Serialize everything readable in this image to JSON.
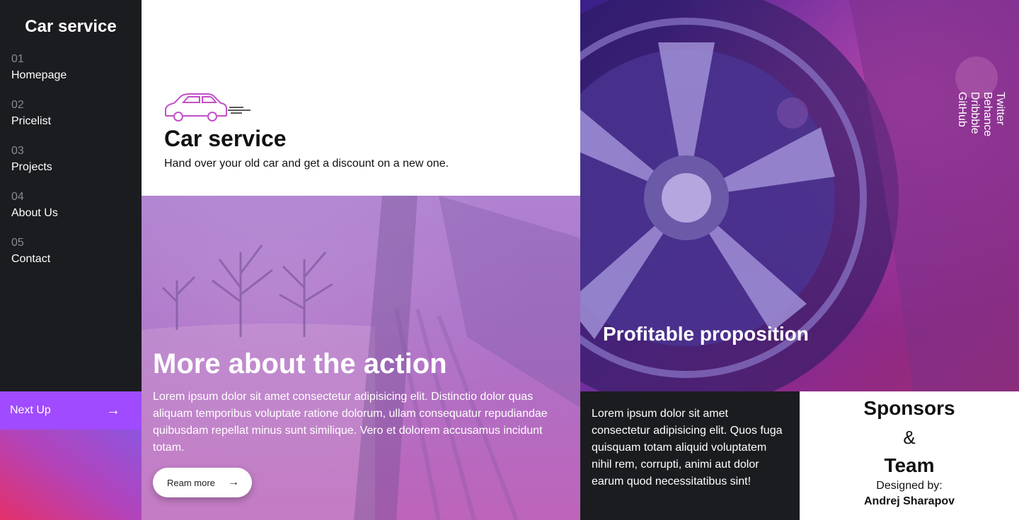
{
  "sidebar": {
    "brand": "Car service",
    "items": [
      {
        "num": "01",
        "label": "Homepage"
      },
      {
        "num": "02",
        "label": "Pricelist"
      },
      {
        "num": "03",
        "label": "Projects"
      },
      {
        "num": "04",
        "label": "About Us"
      },
      {
        "num": "05",
        "label": "Contact"
      }
    ],
    "next_up": "Next Up",
    "next_arrow": "→"
  },
  "hero": {
    "icon": "car-icon",
    "title": "Car service",
    "subtitle": "Hand over your old car and get a discount on a new one."
  },
  "action": {
    "title": "More about the action",
    "text": "Lorem ipsum dolor sit amet consectetur adipisicing elit. Distinctio dolor quas aliquam temporibus voluptate ratione dolorum, ullam consequatur repudiandae quibusdam repellat minus sunt similique. Vero et dolorem accusamus incidunt totam.",
    "button_label": "Ream more",
    "button_arrow": "→"
  },
  "wheel_panel": {
    "title": "Profitable proposition",
    "social": [
      "Twitter",
      "Behance",
      "Dribbble",
      "GitHub"
    ]
  },
  "dark_text": "Lorem ipsum dolor sit amet consectetur adipisicing elit. Quos fuga quisquam totam aliquid voluptatem nihil rem, corrupti, animi aut dolor earum quod necessitatibus sint!",
  "sponsors": {
    "title": "Sponsors",
    "amp": "&",
    "team": "Team",
    "designed_by": "Designed by:",
    "author": "Andrej Sharapov"
  },
  "colors": {
    "accent": "#a04bff",
    "car_icon": "#c24fc9",
    "dark": "#1b1c20"
  }
}
